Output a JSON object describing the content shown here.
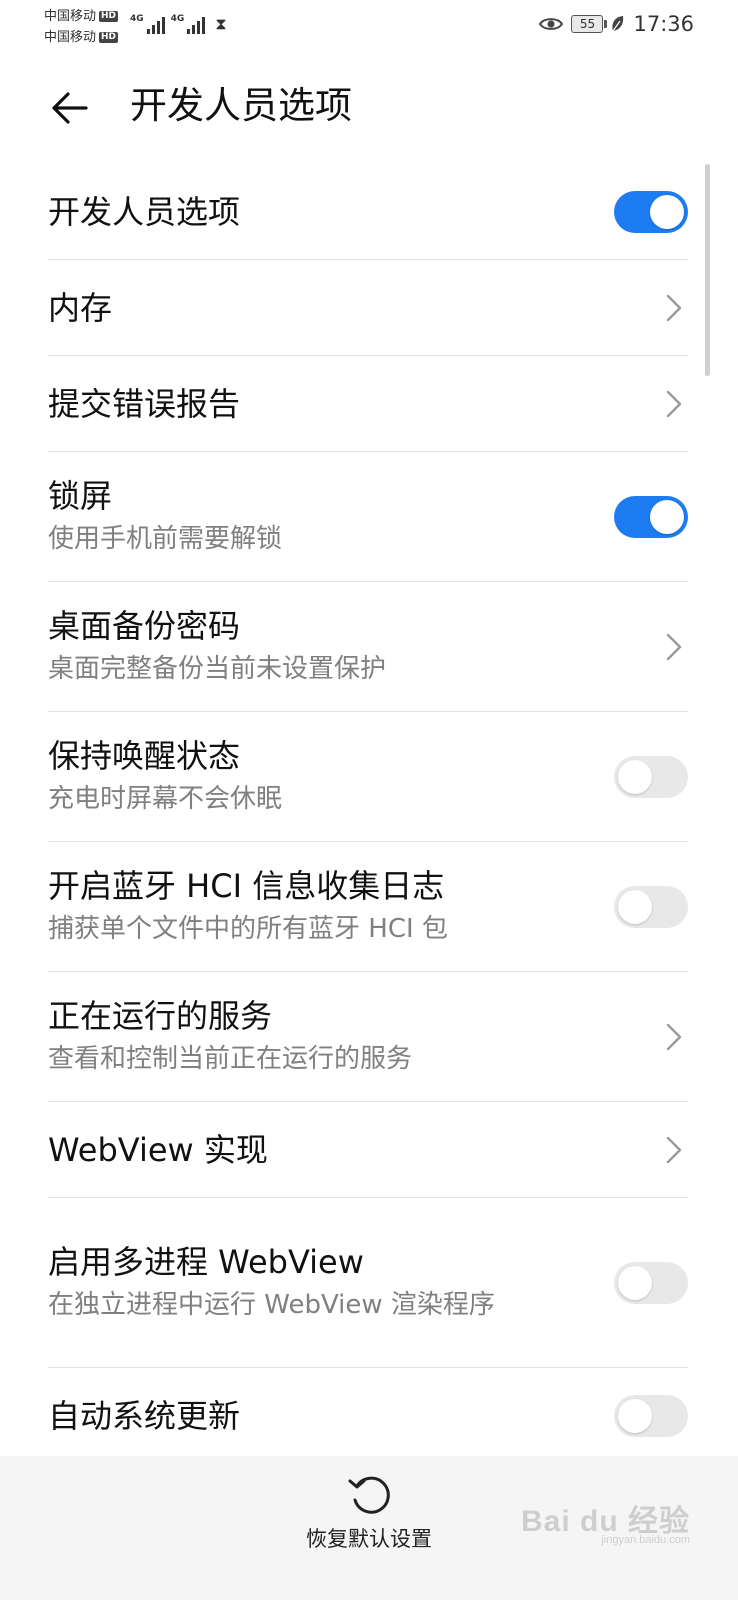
{
  "status_bar": {
    "carrier_1": "中国移动",
    "carrier_2": "中国移动",
    "hd_badge": "HD",
    "network_type": "4G",
    "battery_level": "55",
    "time": "17:36",
    "icons": [
      "signal-icon",
      "hourglass-icon",
      "eye-icon",
      "battery-icon",
      "leaf-icon"
    ]
  },
  "header": {
    "title": "开发人员选项",
    "back_icon": "arrow-left-icon"
  },
  "settings": [
    {
      "title": "开发人员选项",
      "subtitle": "",
      "control": "toggle",
      "checked": true
    },
    {
      "title": "内存",
      "subtitle": "",
      "control": "chevron"
    },
    {
      "title": "提交错误报告",
      "subtitle": "",
      "control": "chevron"
    },
    {
      "title": "锁屏",
      "subtitle": "使用手机前需要解锁",
      "control": "toggle",
      "checked": true
    },
    {
      "title": "桌面备份密码",
      "subtitle": "桌面完整备份当前未设置保护",
      "control": "chevron"
    },
    {
      "title": "保持唤醒状态",
      "subtitle": "充电时屏幕不会休眠",
      "control": "toggle",
      "checked": false
    },
    {
      "title": "开启蓝牙 HCI 信息收集日志",
      "subtitle": "捕获单个文件中的所有蓝牙 HCI 包",
      "control": "toggle",
      "checked": false
    },
    {
      "title": "正在运行的服务",
      "subtitle": "查看和控制当前正在运行的服务",
      "control": "chevron"
    },
    {
      "title": "WebView 实现",
      "subtitle": "",
      "control": "chevron"
    },
    {
      "title": "启用多进程 WebView",
      "subtitle": "在独立进程中运行 WebView 渲染程序",
      "control": "toggle",
      "checked": false
    },
    {
      "title": "自动系统更新",
      "subtitle": "",
      "control": "toggle",
      "checked": false
    }
  ],
  "bottom_bar": {
    "restore_label": "恢复默认设置",
    "restore_icon": "reset-icon"
  },
  "watermark": {
    "logo": "Bai du 经验",
    "url": "jingyan.baidu.com"
  },
  "colors": {
    "accent": "#1e7cf2",
    "toggle_off": "#e8e8e8",
    "divider": "#e3e3e3",
    "subtitle": "#808080",
    "bottom_bar_bg": "#f5f5f5"
  }
}
